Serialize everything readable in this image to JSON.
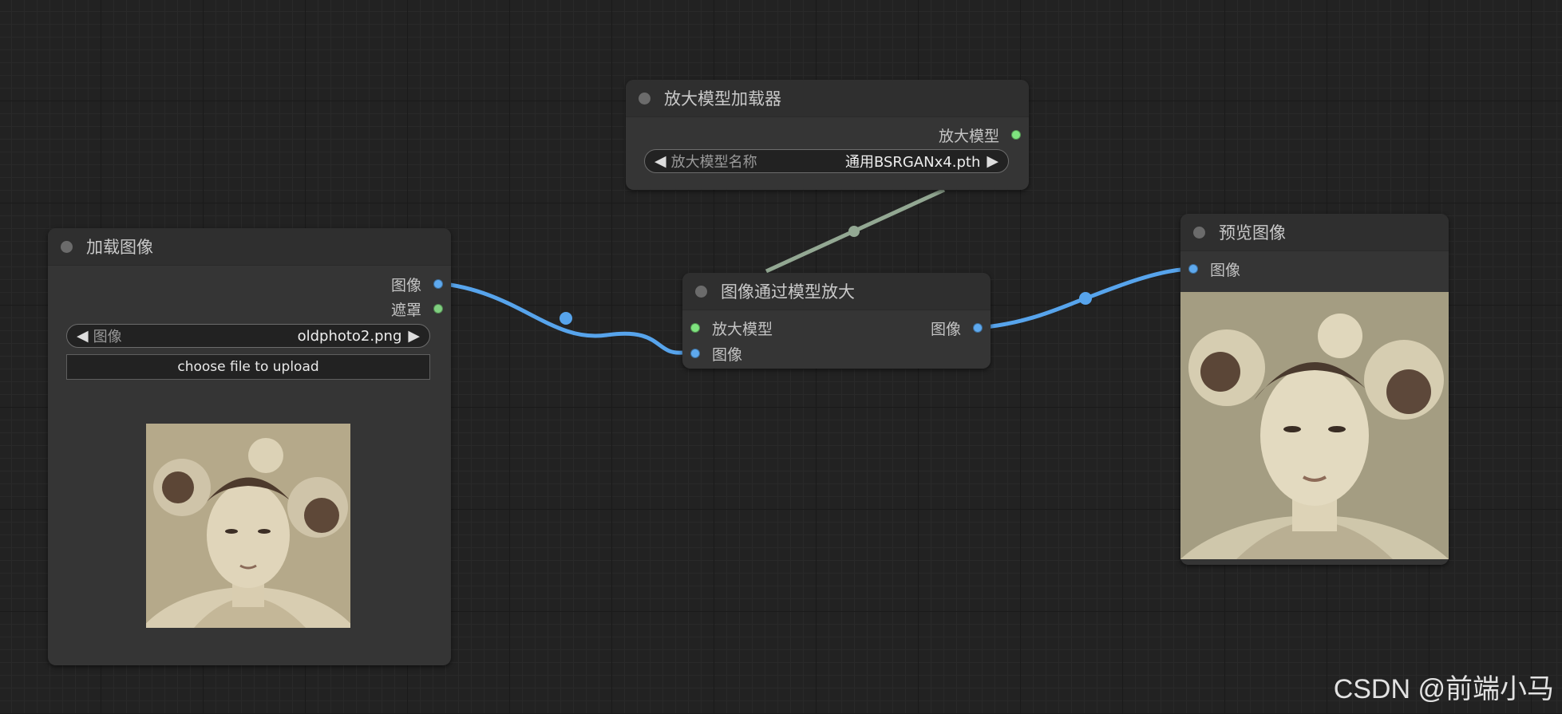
{
  "colors": {
    "image_slot": "#5ea9ee",
    "mask_slot": "#7fcf7f",
    "model_slot": "#7fe37f",
    "image_link": "#57a4ec",
    "model_link": "#93a893",
    "title_dot": "#6b6b6b"
  },
  "nodes": {
    "load_image": {
      "title": "加载图像",
      "outputs": [
        "图像",
        "遮罩"
      ],
      "combo": {
        "label": "图像",
        "value": "oldphoto2.png"
      },
      "upload_label": "choose file to upload",
      "preview_icon": "old-portrait-photo"
    },
    "upscale_loader": {
      "title": "放大模型加载器",
      "output": "放大模型",
      "combo": {
        "label": "放大模型名称",
        "value": "通用BSRGANx4.pth"
      }
    },
    "image_upscale": {
      "title": "图像通过模型放大",
      "inputs": [
        "放大模型",
        "图像"
      ],
      "output": "图像"
    },
    "preview_image": {
      "title": "预览图像",
      "input": "图像",
      "preview_icon": "upscaled-portrait-photo"
    }
  },
  "watermark": "CSDN @前端小马"
}
